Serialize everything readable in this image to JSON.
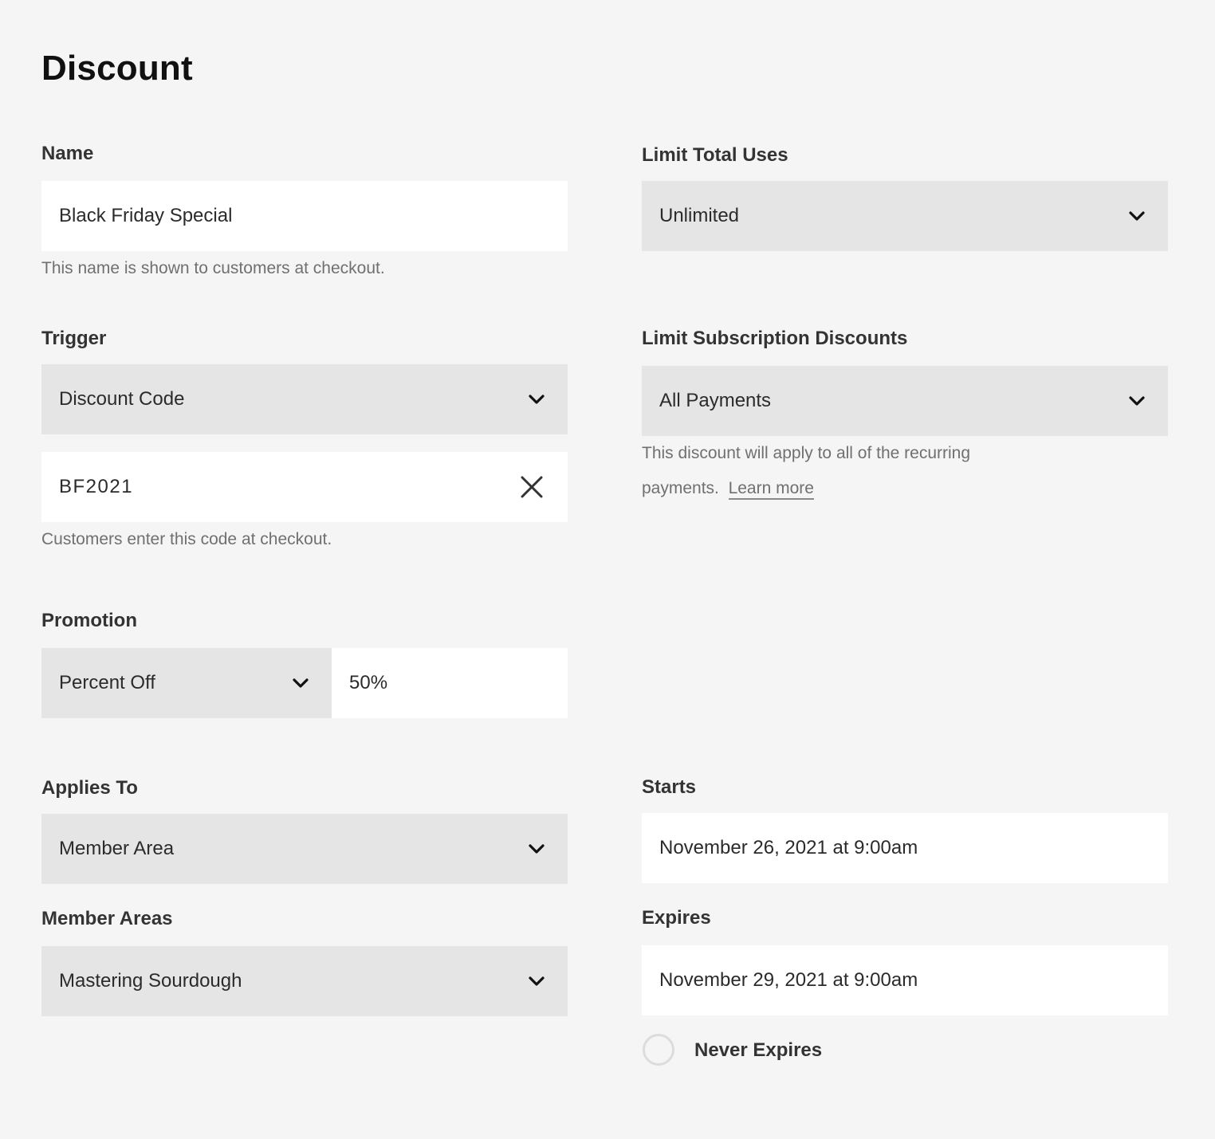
{
  "page": {
    "title": "Discount"
  },
  "name": {
    "label": "Name",
    "value": "Black Friday Special",
    "help": "This name is shown to customers at checkout."
  },
  "limit_total_uses": {
    "label": "Limit Total Uses",
    "selected": "Unlimited"
  },
  "trigger": {
    "label": "Trigger",
    "selected": "Discount Code",
    "code_value": "BF2021",
    "help": "Customers enter this code at checkout."
  },
  "limit_subscription_discounts": {
    "label": "Limit Subscription Discounts",
    "selected": "All Payments",
    "help_line1": "This discount will apply to all of the recurring",
    "help_line2": "payments.",
    "learn_more": "Learn more"
  },
  "promotion": {
    "label": "Promotion",
    "selected": "Percent Off",
    "amount": "50%"
  },
  "applies_to": {
    "label": "Applies To",
    "selected": "Member Area"
  },
  "member_areas": {
    "label": "Member Areas",
    "selected": "Mastering Sourdough"
  },
  "starts": {
    "label": "Starts",
    "value": "November 26, 2021 at 9:00am"
  },
  "expires": {
    "label": "Expires",
    "value": "November 29, 2021 at 9:00am",
    "never_expires_label": "Never Expires",
    "never_expires_checked": false
  },
  "icons": {
    "dropdown": "chevron-down-icon",
    "clear": "close-icon"
  },
  "colors": {
    "background": "#f5f5f5",
    "input_white": "#ffffff",
    "select_grey": "#e5e5e5",
    "label_text": "#333333",
    "help_text": "#707070"
  }
}
